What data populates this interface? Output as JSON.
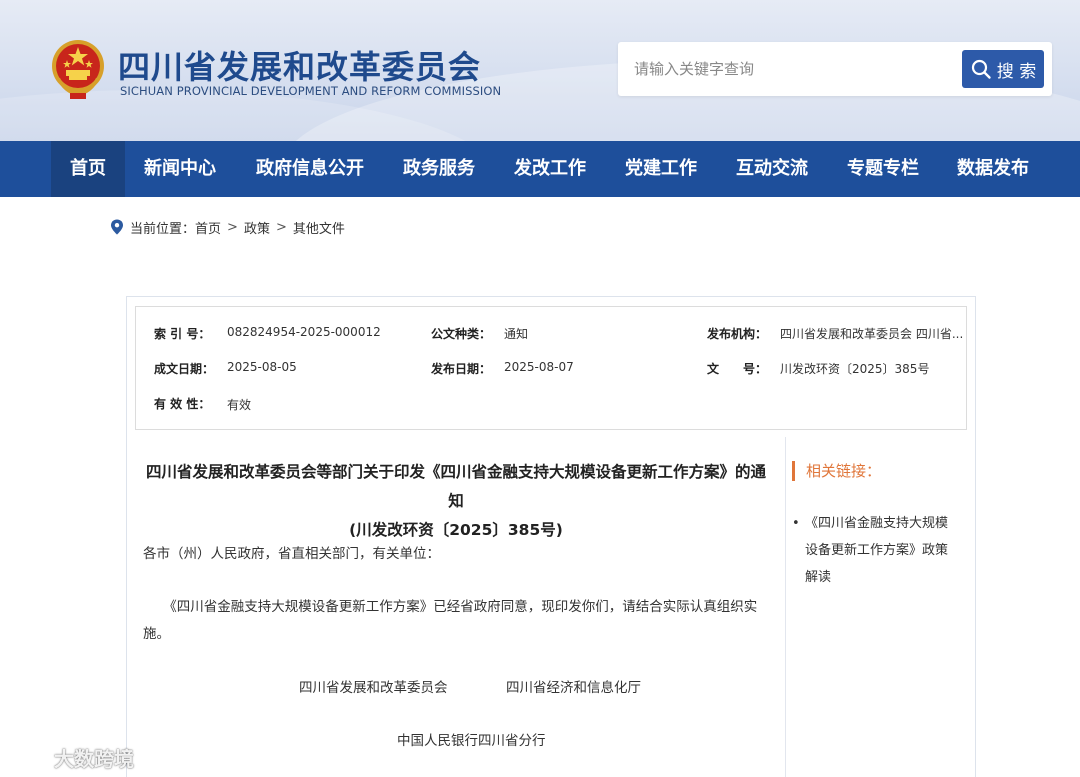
{
  "header": {
    "title": "四川省发展和改革委员会",
    "subtitle": "SICHUAN PROVINCIAL DEVELOPMENT AND REFORM COMMISSION",
    "search": {
      "placeholder": "请输入关键字查询",
      "button_label": "搜 索"
    }
  },
  "nav": {
    "items": [
      {
        "label": "首页"
      },
      {
        "label": "新闻中心"
      },
      {
        "label": "政府信息公开"
      },
      {
        "label": "政务服务"
      },
      {
        "label": "发改工作"
      },
      {
        "label": "党建工作"
      },
      {
        "label": "互动交流"
      },
      {
        "label": "专题专栏"
      },
      {
        "label": "数据发布"
      }
    ]
  },
  "breadcrumb": {
    "prefix": "当前位置：",
    "items": [
      "首页",
      "政策",
      "其他文件"
    ],
    "separator": ">"
  },
  "meta": {
    "index_label": "索 引 号：",
    "index_value": "082824954-2025-000012",
    "type_label": "公文种类：",
    "type_value": "通知",
    "org_label": "发布机构：",
    "org_value": "四川省发展和改革委员会 四川省...",
    "date_written_label": "成文日期：",
    "date_written_value": "2025-08-05",
    "date_published_label": "发布日期：",
    "date_published_value": "2025-08-07",
    "doc_no_label": "文　　号：",
    "doc_no_value": "川发改环资〔2025〕385号",
    "validity_label": "有 效 性：",
    "validity_value": "有效"
  },
  "article": {
    "title_line1": "四川省发展和改革委员会等部门关于印发《四川省金融支持大规模设备更新工作方案》的通知",
    "title_line2": "(川发改环资〔2025〕385号)",
    "salutation": "各市（州）人民政府，省直相关部门，有关单位：",
    "body_line1": "　　《四川省金融支持大规模设备更新工作方案》已经省政府同意，现印发你们，请结合实际认真组织实",
    "body_line2": "施。",
    "signer1": "四川省发展和改革委员会",
    "signer2": "四川省经济和信息化厅",
    "signer3": "中国人民银行四川省分行"
  },
  "related": {
    "title": "相关链接：",
    "links": [
      {
        "line1": "《四川省金融支持大规模",
        "line2": "设备更新工作方案》政策",
        "line3": "解读"
      }
    ]
  },
  "watermark": {
    "text": "大数跨境"
  },
  "colors": {
    "brand_blue": "#1e4f9b",
    "nav_active": "#1a427f",
    "accent_orange": "#e0763a",
    "title_blue": "#1f4a8d"
  },
  "icons": {
    "emblem": "national-emblem-icon",
    "search": "search-icon",
    "location": "location-pin-icon",
    "watermark": "watermark-logo-icon"
  }
}
